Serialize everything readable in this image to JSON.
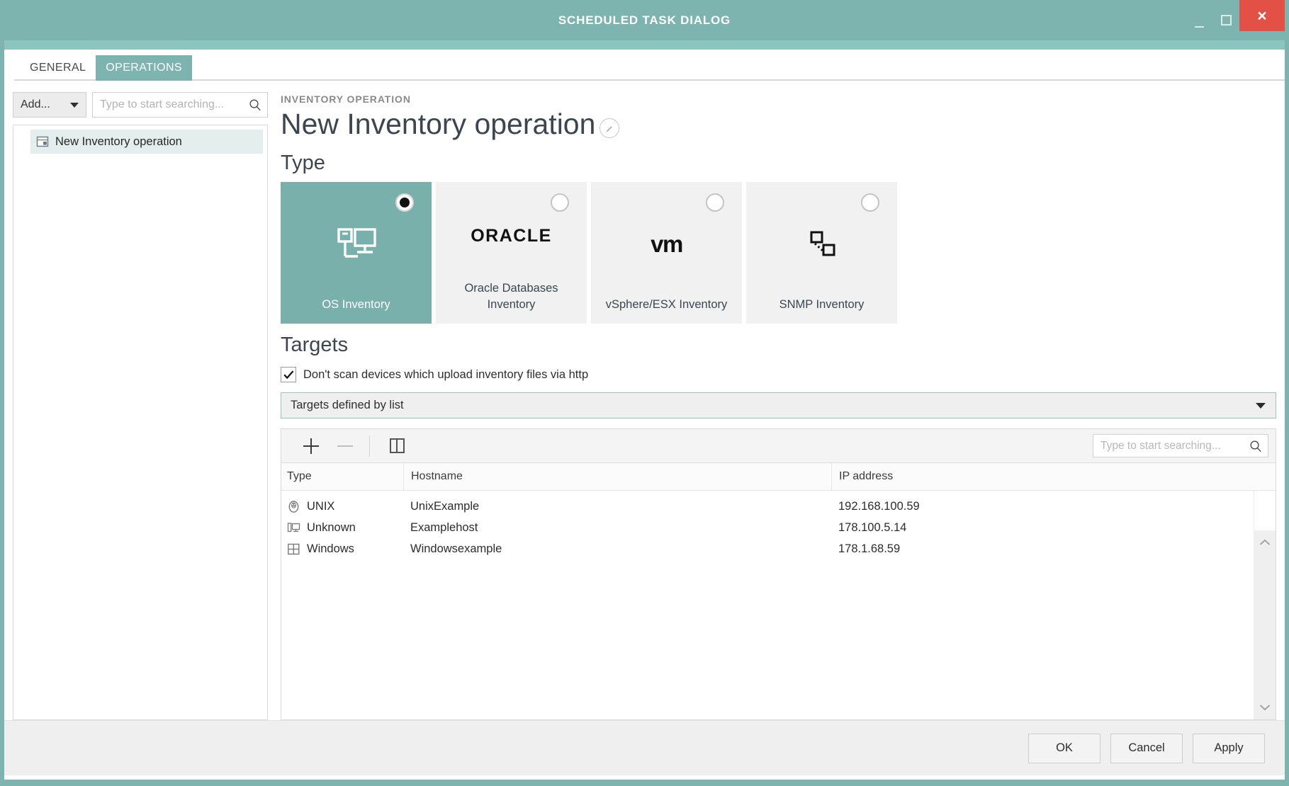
{
  "window": {
    "title": "SCHEDULED TASK DIALOG",
    "minimize_label": "minimize",
    "maximize_label": "maximize",
    "close_label": "×"
  },
  "tabs": [
    {
      "label": "GENERAL",
      "active": false
    },
    {
      "label": "OPERATIONS",
      "active": true
    }
  ],
  "left_panel": {
    "add_button_label": "Add...",
    "search_placeholder": "Type to start searching...",
    "tree_items": [
      {
        "label": "New Inventory operation",
        "icon": "inventory-operation-icon",
        "selected": true
      }
    ]
  },
  "detail": {
    "kicker": "INVENTORY OPERATION",
    "title": "New Inventory operation",
    "edit_icon": "edit-pencil-icon",
    "type_heading": "Type",
    "targets_heading": "Targets"
  },
  "type_cards": [
    {
      "label": "OS Inventory",
      "icon": "os-inventory-icon",
      "selected": true
    },
    {
      "label": "Oracle Databases Inventory",
      "logo_text": "ORACLE",
      "icon": "oracle-logo-icon",
      "selected": false
    },
    {
      "label": "vSphere/ESX Inventory",
      "logo_text": "vm",
      "icon": "vmware-logo-icon",
      "selected": false
    },
    {
      "label": "SNMP Inventory",
      "icon": "snmp-nodes-icon",
      "selected": false
    }
  ],
  "targets": {
    "checkbox_label": "Don't scan devices which upload inventory files via http",
    "checkbox_checked": true,
    "mode_value": "Targets defined by list",
    "toolbar": {
      "add_label": "+",
      "remove_label": "−",
      "columns_label": "columns",
      "remove_disabled": true,
      "search_placeholder": "Type to start searching..."
    },
    "columns": [
      "Type",
      "Hostname",
      "IP address"
    ],
    "rows": [
      {
        "type": "UNIX",
        "type_icon": "penguin-icon",
        "hostname": "UnixExample",
        "ip": "192.168.100.59"
      },
      {
        "type": "Unknown",
        "type_icon": "desktop-pc-icon",
        "hostname": "Examplehost",
        "ip": "178.100.5.14"
      },
      {
        "type": "Windows",
        "type_icon": "windows-logo-icon",
        "hostname": "Windowsexample",
        "ip": "178.1.68.59"
      }
    ]
  },
  "footer": {
    "ok_label": "OK",
    "cancel_label": "Cancel",
    "apply_label": "Apply"
  },
  "colors": {
    "accent_teal": "#7db4b0",
    "accent_teal_light": "#8cc4c0",
    "close_red": "#e35045",
    "selected_card": "#79b0ac",
    "panel_grey": "#efefef"
  }
}
